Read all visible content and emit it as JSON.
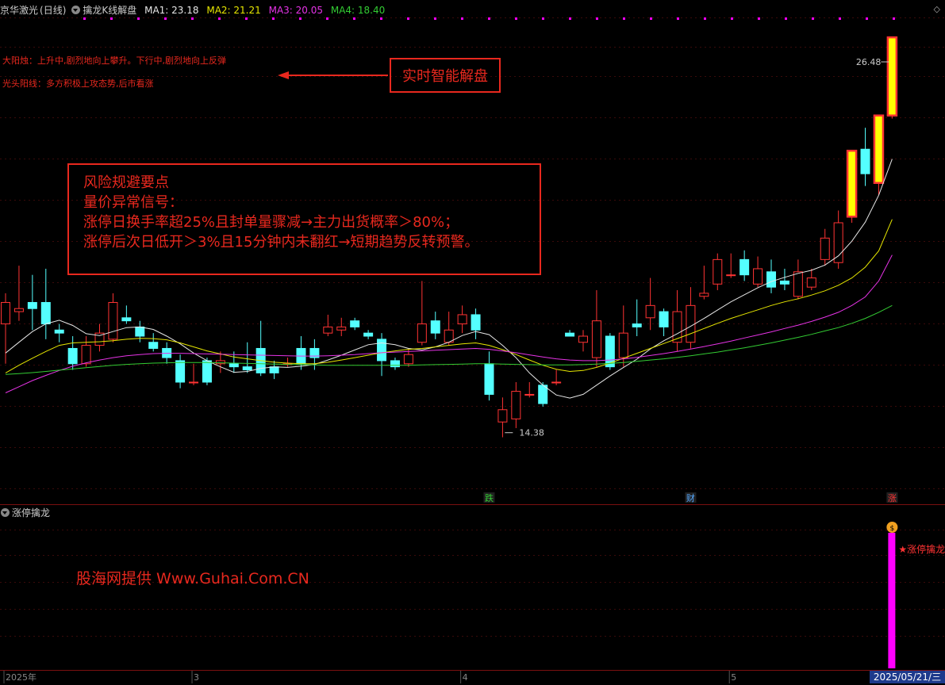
{
  "header": {
    "stock": "京华激光",
    "period": "(日线)",
    "indicator": "擒龙K线解盘",
    "ma": [
      {
        "label": "MA1: 23.18",
        "color": "#e6e6e6"
      },
      {
        "label": "MA2: 21.21",
        "color": "#e6e600"
      },
      {
        "label": "MA3: 20.05",
        "color": "#e633e6"
      },
      {
        "label": "MA4: 18.40",
        "color": "#33cc33"
      }
    ]
  },
  "notes": {
    "line1": "大阳烛：上升中,剧烈地向上攀升。下行中,剧烈地向上反弹",
    "line2": "光头阳线：多方积极上攻态势,后市看涨"
  },
  "callout": {
    "label": "实时智能解盘"
  },
  "risk": {
    "title": "风险规避要点",
    "subtitle": "量价异常信号：",
    "line1": "涨停日换手率超25%且封单量骤减→主力出货概率＞80%；",
    "line2": "涨停后次日低开＞3%且15分钟内未翻红→短期趋势反转预警。"
  },
  "sub_panel": {
    "name": "涨停擒龙",
    "signal_label": "★涨停擒龙"
  },
  "watermark": "股海网提供 Www.Guhai.Com.CN",
  "footer": {
    "date": "2025/05/21/三"
  },
  "colors": {
    "up": "#ff3333",
    "down": "#54ffff",
    "limit_fill": "#ffff00",
    "signal": "#ff00ff",
    "ma1": "#e6e6e6",
    "ma2": "#e6e600",
    "ma3": "#e633e6",
    "ma4": "#33cc33"
  },
  "chart_data": {
    "type": "candlestick",
    "ylim": [
      12.2,
      27.8
    ],
    "x_labels": [
      "2025年",
      "3",
      "4",
      "5"
    ],
    "x_label_index": [
      0,
      14,
      34,
      54
    ],
    "price_labels": [
      {
        "text": "26.48",
        "index": 66,
        "value": 26.48
      },
      {
        "text": "14.38",
        "index": 38,
        "value": 14.38
      }
    ],
    "event_labels": [
      {
        "text": "跌",
        "index": 36,
        "color": "#33cc33"
      },
      {
        "text": "财",
        "index": 51,
        "color": "#54a8ff"
      },
      {
        "text": "涨",
        "index": 66,
        "color": "#ff3333"
      }
    ],
    "candles": [
      [
        17.8,
        18.5,
        18.8,
        16.5
      ],
      [
        18.2,
        18.3,
        19.7,
        17.9
      ],
      [
        18.5,
        18.3,
        19.4,
        17.6
      ],
      [
        18.5,
        17.8,
        19.6,
        17.3
      ],
      [
        17.6,
        17.5,
        17.8,
        17.2
      ],
      [
        17.0,
        16.5,
        17.4,
        16.3
      ],
      [
        16.5,
        17.1,
        17.4,
        16.4
      ],
      [
        17.1,
        17.5,
        17.8,
        16.9
      ],
      [
        17.3,
        18.5,
        18.8,
        17.2
      ],
      [
        18.0,
        17.9,
        18.4,
        17.8
      ],
      [
        17.7,
        17.4,
        17.9,
        17.2
      ],
      [
        17.2,
        17.0,
        17.5,
        16.9
      ],
      [
        17.0,
        16.7,
        17.2,
        16.5
      ],
      [
        16.6,
        15.9,
        16.8,
        15.7
      ],
      [
        15.9,
        15.9,
        16.5,
        15.8
      ],
      [
        16.6,
        15.9,
        16.7,
        15.8
      ],
      [
        16.5,
        16.6,
        16.9,
        16.2
      ],
      [
        16.5,
        16.4,
        16.9,
        16.2
      ],
      [
        16.4,
        16.3,
        17.2,
        16.2
      ],
      [
        17.0,
        16.2,
        17.9,
        16.1
      ],
      [
        16.4,
        16.2,
        16.6,
        16.0
      ],
      [
        16.5,
        16.5,
        16.7,
        16.4
      ],
      [
        17.0,
        16.5,
        17.4,
        16.3
      ],
      [
        17.0,
        16.7,
        17.3,
        16.3
      ],
      [
        17.5,
        17.7,
        18.1,
        17.4
      ],
      [
        17.6,
        17.7,
        18.0,
        17.4
      ],
      [
        17.9,
        17.7,
        18.0,
        17.6
      ],
      [
        17.5,
        17.4,
        17.6,
        17.3
      ],
      [
        17.3,
        16.6,
        17.5,
        16.1
      ],
      [
        16.6,
        16.4,
        16.7,
        16.3
      ],
      [
        16.5,
        16.8,
        17.0,
        16.4
      ],
      [
        17.2,
        17.8,
        19.2,
        17.1
      ],
      [
        17.9,
        17.5,
        18.2,
        17.3
      ],
      [
        17.2,
        17.6,
        18.2,
        17.1
      ],
      [
        17.8,
        18.1,
        18.4,
        17.5
      ],
      [
        18.1,
        17.6,
        18.3,
        17.3
      ],
      [
        16.5,
        15.5,
        16.9,
        15.3
      ],
      [
        14.6,
        15.0,
        15.4,
        14.1
      ],
      [
        14.7,
        15.6,
        15.9,
        14.4
      ],
      [
        15.5,
        15.5,
        15.9,
        15.4
      ],
      [
        15.8,
        15.2,
        15.9,
        15.1
      ],
      [
        15.9,
        15.9,
        16.3,
        15.8
      ],
      [
        17.5,
        17.4,
        17.6,
        17.4
      ],
      [
        17.2,
        17.4,
        17.6,
        16.9
      ],
      [
        16.7,
        17.9,
        18.9,
        16.4
      ],
      [
        17.4,
        16.4,
        17.5,
        16.3
      ],
      [
        16.7,
        17.5,
        18.4,
        16.4
      ],
      [
        17.8,
        17.7,
        18.6,
        17.4
      ],
      [
        18.0,
        18.4,
        19.3,
        17.6
      ],
      [
        18.2,
        17.7,
        18.3,
        17.4
      ],
      [
        17.2,
        18.2,
        18.9,
        16.9
      ],
      [
        17.2,
        18.4,
        19.0,
        17.0
      ],
      [
        18.7,
        18.8,
        19.7,
        18.6
      ],
      [
        19.1,
        19.9,
        20.1,
        18.9
      ],
      [
        19.4,
        19.4,
        20.1,
        19.3
      ],
      [
        19.9,
        19.4,
        20.2,
        19.2
      ],
      [
        19.1,
        19.6,
        20.0,
        19.0
      ],
      [
        19.5,
        19.0,
        19.9,
        18.8
      ],
      [
        19.2,
        19.1,
        19.6,
        18.9
      ],
      [
        18.7,
        19.5,
        19.9,
        18.6
      ],
      [
        19.0,
        19.3,
        19.6,
        18.9
      ],
      [
        19.9,
        20.6,
        20.9,
        19.7
      ],
      [
        19.8,
        21.1,
        21.5,
        19.6
      ],
      [
        21.3,
        23.45,
        23.45,
        21.1
      ],
      [
        23.5,
        22.7,
        24.2,
        22.3
      ],
      [
        22.4,
        24.6,
        24.6,
        22.0
      ],
      [
        24.6,
        27.15,
        27.15,
        24.5
      ]
    ],
    "ma_series": [
      {
        "name": "MA1",
        "values": [
          16.85,
          17.2,
          17.55,
          17.8,
          17.92,
          17.75,
          17.48,
          17.42,
          17.55,
          17.68,
          17.7,
          17.62,
          17.4,
          17.15,
          16.85,
          16.6,
          16.4,
          16.22,
          16.25,
          16.35,
          16.4,
          16.38,
          16.42,
          16.48,
          16.62,
          16.78,
          16.95,
          17.12,
          17.18,
          17.12,
          17.0,
          16.95,
          17.05,
          17.2,
          17.42,
          17.55,
          17.45,
          17.1,
          16.7,
          16.2,
          15.8,
          15.48,
          15.38,
          15.5,
          15.8,
          16.1,
          16.38,
          16.65,
          16.98,
          17.25,
          17.48,
          17.72,
          17.98,
          18.25,
          18.52,
          18.75,
          18.98,
          19.18,
          19.32,
          19.45,
          19.55,
          19.72,
          20.02,
          20.5,
          21.12,
          22.0,
          23.18
        ]
      },
      {
        "name": "MA2",
        "values": [
          16.2,
          16.45,
          16.68,
          16.9,
          17.1,
          17.18,
          17.2,
          17.22,
          17.25,
          17.3,
          17.33,
          17.32,
          17.28,
          17.18,
          17.05,
          16.92,
          16.82,
          16.72,
          16.66,
          16.6,
          16.55,
          16.52,
          16.5,
          16.5,
          16.55,
          16.62,
          16.7,
          16.78,
          16.86,
          16.92,
          16.97,
          17.0,
          17.05,
          17.1,
          17.15,
          17.18,
          17.1,
          16.96,
          16.8,
          16.62,
          16.45,
          16.32,
          16.25,
          16.28,
          16.38,
          16.52,
          16.68,
          16.84,
          17.0,
          17.16,
          17.32,
          17.48,
          17.65,
          17.82,
          17.98,
          18.12,
          18.26,
          18.4,
          18.52,
          18.62,
          18.74,
          18.88,
          19.06,
          19.3,
          19.65,
          20.18,
          21.21
        ]
      },
      {
        "name": "MA3",
        "values": [
          15.55,
          15.75,
          15.95,
          16.12,
          16.28,
          16.42,
          16.53,
          16.62,
          16.7,
          16.76,
          16.8,
          16.83,
          16.84,
          16.84,
          16.83,
          16.82,
          16.81,
          16.8,
          16.79,
          16.78,
          16.77,
          16.76,
          16.75,
          16.75,
          16.76,
          16.78,
          16.8,
          16.83,
          16.86,
          16.88,
          16.9,
          16.92,
          16.94,
          16.96,
          16.98,
          17.0,
          16.97,
          16.92,
          16.86,
          16.79,
          16.72,
          16.66,
          16.62,
          16.6,
          16.6,
          16.62,
          16.66,
          16.71,
          16.77,
          16.83,
          16.9,
          16.98,
          17.06,
          17.15,
          17.24,
          17.34,
          17.44,
          17.54,
          17.65,
          17.76,
          17.88,
          18.02,
          18.18,
          18.4,
          18.68,
          19.2,
          20.05
        ]
      },
      {
        "name": "MA4",
        "values": [
          16.15,
          16.18,
          16.21,
          16.25,
          16.29,
          16.33,
          16.37,
          16.41,
          16.45,
          16.48,
          16.5,
          16.52,
          16.53,
          16.54,
          16.54,
          16.54,
          16.53,
          16.52,
          16.51,
          16.5,
          16.49,
          16.48,
          16.47,
          16.46,
          16.45,
          16.45,
          16.45,
          16.45,
          16.45,
          16.45,
          16.45,
          16.46,
          16.47,
          16.48,
          16.49,
          16.5,
          16.5,
          16.49,
          16.48,
          16.47,
          16.46,
          16.46,
          16.46,
          16.47,
          16.49,
          16.51,
          16.54,
          16.58,
          16.62,
          16.66,
          16.71,
          16.76,
          16.82,
          16.88,
          16.95,
          17.02,
          17.1,
          17.18,
          17.27,
          17.36,
          17.46,
          17.57,
          17.68,
          17.82,
          17.98,
          18.18,
          18.4
        ]
      }
    ],
    "limit_up_days": [
      63,
      65,
      66
    ],
    "signal_day": 66
  }
}
